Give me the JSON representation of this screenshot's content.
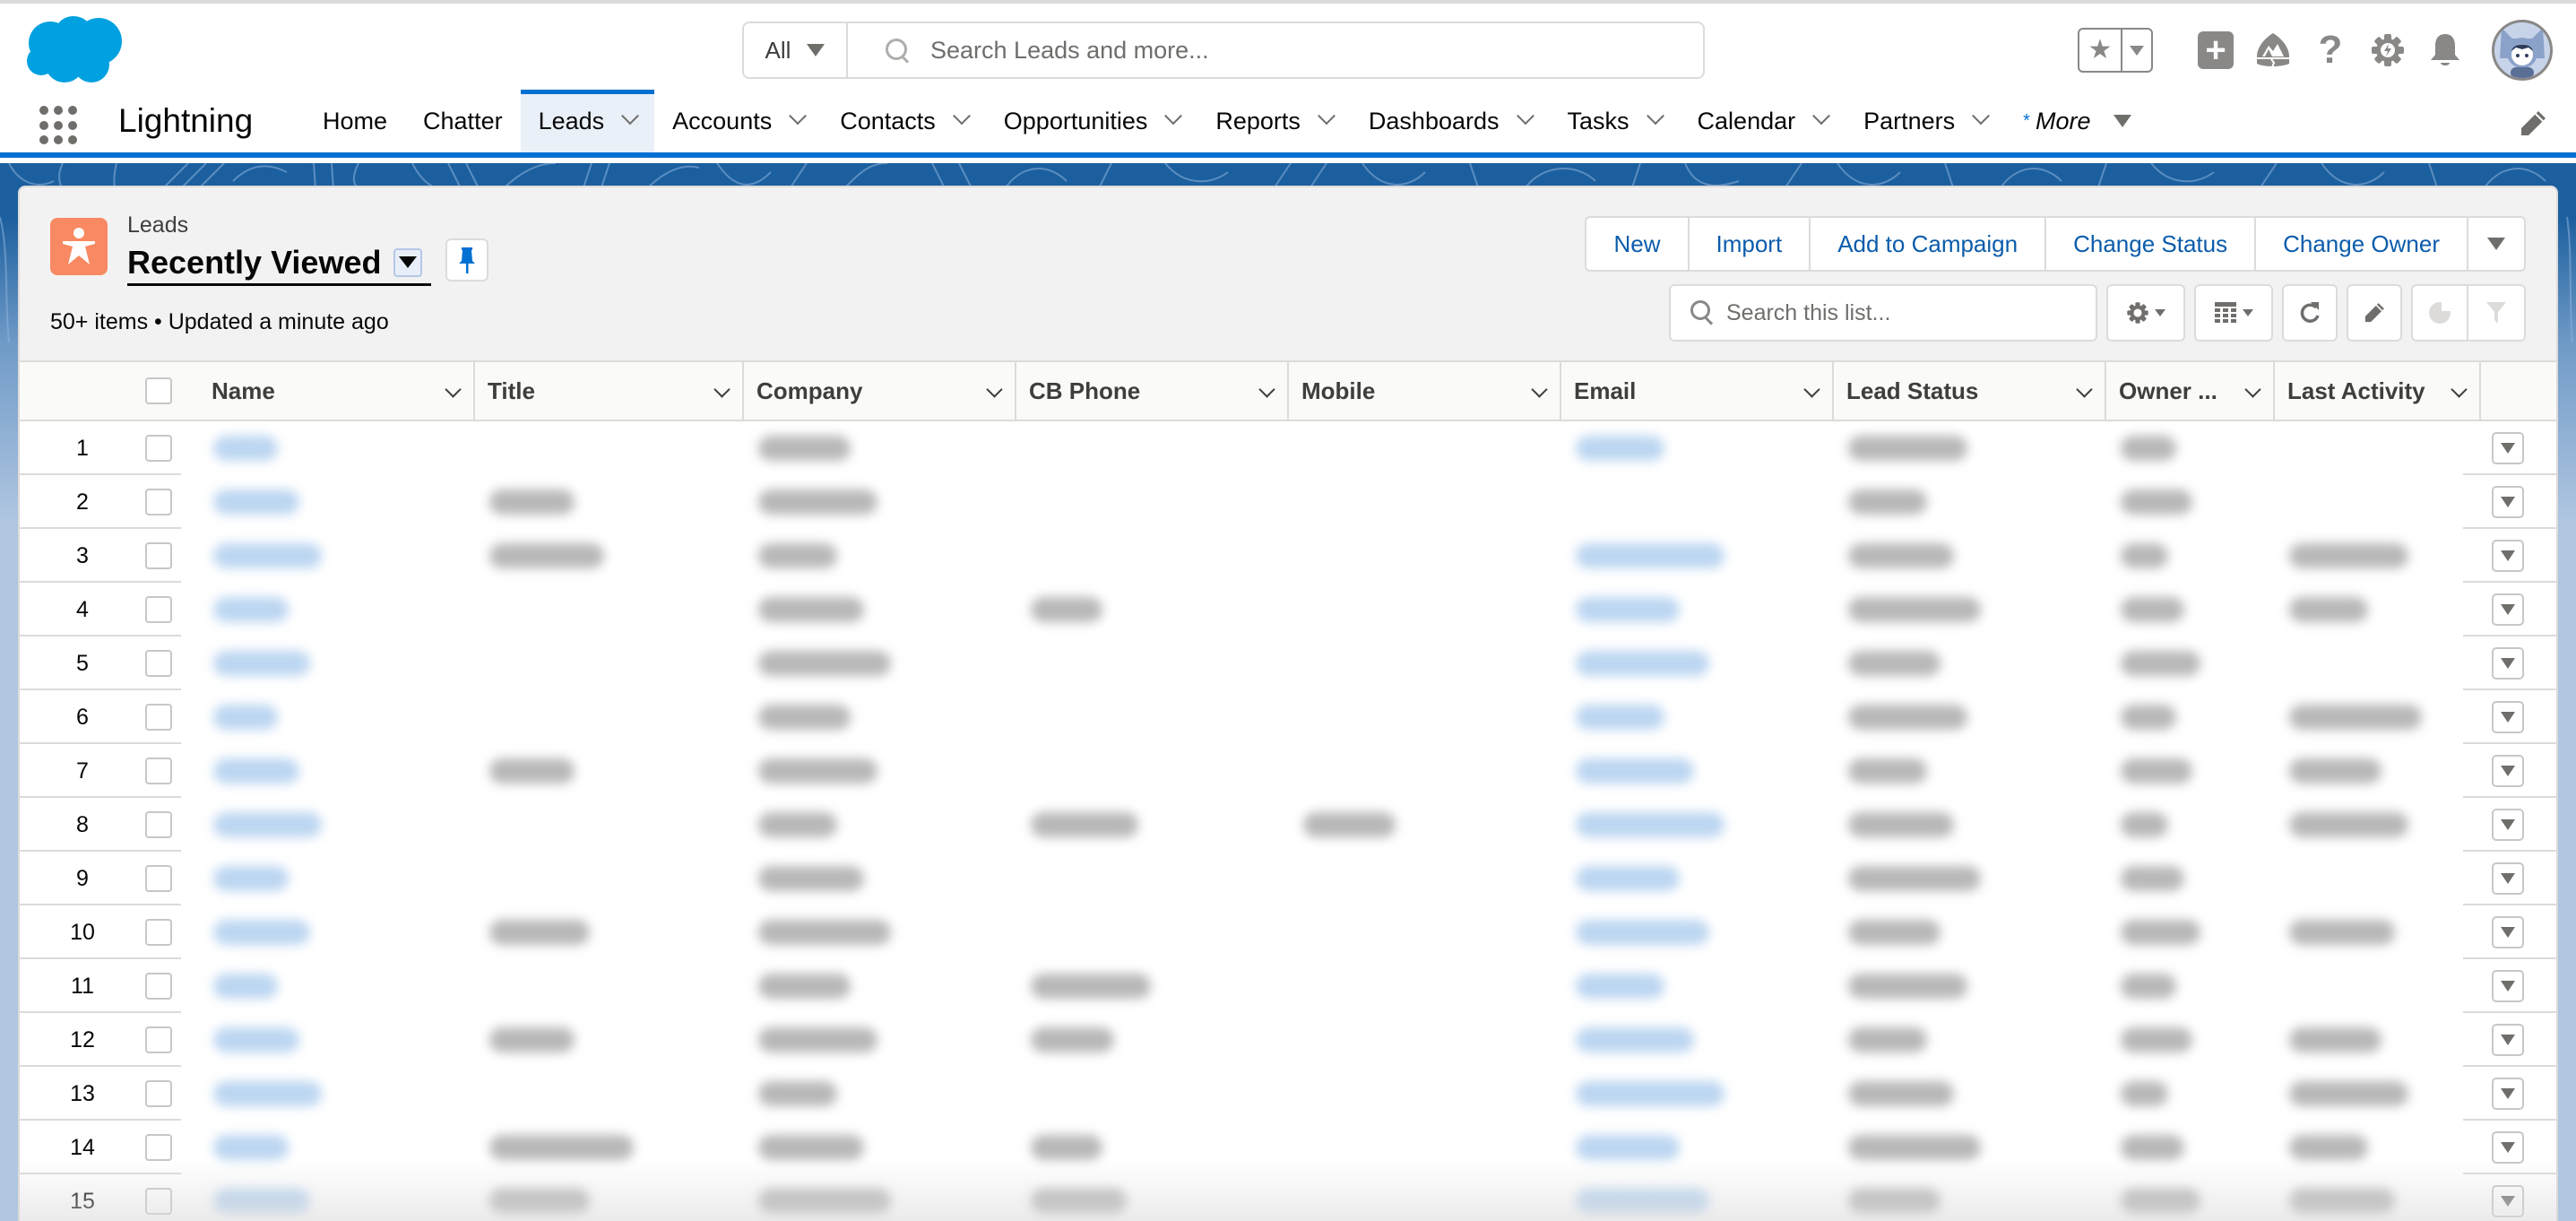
{
  "header": {
    "logo": "salesforce-cloud-logo",
    "search_scope": "All",
    "search_placeholder": "Search Leads and more...",
    "icons": [
      "favorites-star-icon",
      "favorites-dropdown-icon",
      "global-actions-plus-icon",
      "trailhead-icon",
      "help-icon",
      "setup-gear-icon",
      "notifications-bell-icon",
      "user-avatar"
    ]
  },
  "nav": {
    "app_name": "Lightning",
    "items": [
      {
        "label": "Home",
        "dropdown": false,
        "active": false
      },
      {
        "label": "Chatter",
        "dropdown": false,
        "active": false
      },
      {
        "label": "Leads",
        "dropdown": true,
        "active": true
      },
      {
        "label": "Accounts",
        "dropdown": true,
        "active": false
      },
      {
        "label": "Contacts",
        "dropdown": true,
        "active": false
      },
      {
        "label": "Opportunities",
        "dropdown": true,
        "active": false
      },
      {
        "label": "Reports",
        "dropdown": true,
        "active": false
      },
      {
        "label": "Dashboards",
        "dropdown": true,
        "active": false
      },
      {
        "label": "Tasks",
        "dropdown": true,
        "active": false
      },
      {
        "label": "Calendar",
        "dropdown": true,
        "active": false
      },
      {
        "label": "Partners",
        "dropdown": true,
        "active": false
      }
    ],
    "more_prefix": "*",
    "more_label": "More"
  },
  "list": {
    "object_label": "Leads",
    "view_name": "Recently Viewed",
    "meta": "50+ items • Updated a minute ago",
    "actions": [
      "New",
      "Import",
      "Add to Campaign",
      "Change Status",
      "Change Owner"
    ],
    "search_placeholder": "Search this list...",
    "colors": {
      "object_icon": "#f88962",
      "brand_blue": "#0070d2",
      "action_text": "#0b5cab"
    }
  },
  "table": {
    "columns": [
      "Name",
      "Title",
      "Company",
      "CB Phone",
      "Mobile",
      "Email",
      "Lead Status",
      "Owner ...",
      "Last Activity"
    ],
    "note": "cell values are blurred/redacted in the screenshot; true = cell contains a redacted value",
    "rows": [
      {
        "n": "1",
        "cells": [
          true,
          false,
          true,
          false,
          false,
          true,
          true,
          true,
          false
        ]
      },
      {
        "n": "2",
        "cells": [
          true,
          true,
          true,
          false,
          false,
          false,
          true,
          true,
          false
        ]
      },
      {
        "n": "3",
        "cells": [
          true,
          true,
          true,
          false,
          false,
          true,
          true,
          true,
          true
        ]
      },
      {
        "n": "4",
        "cells": [
          true,
          false,
          true,
          true,
          false,
          true,
          true,
          true,
          true
        ]
      },
      {
        "n": "5",
        "cells": [
          true,
          false,
          true,
          false,
          false,
          true,
          true,
          true,
          false
        ]
      },
      {
        "n": "6",
        "cells": [
          true,
          false,
          true,
          false,
          false,
          true,
          true,
          true,
          true
        ]
      },
      {
        "n": "7",
        "cells": [
          true,
          true,
          true,
          false,
          false,
          true,
          true,
          true,
          true
        ]
      },
      {
        "n": "8",
        "cells": [
          true,
          false,
          true,
          true,
          true,
          true,
          true,
          true,
          true
        ]
      },
      {
        "n": "9",
        "cells": [
          true,
          false,
          true,
          false,
          false,
          true,
          true,
          true,
          false
        ]
      },
      {
        "n": "10",
        "cells": [
          true,
          true,
          true,
          false,
          false,
          true,
          true,
          true,
          true
        ]
      },
      {
        "n": "11",
        "cells": [
          true,
          false,
          true,
          true,
          false,
          true,
          true,
          true,
          false
        ]
      },
      {
        "n": "12",
        "cells": [
          true,
          true,
          true,
          true,
          false,
          true,
          true,
          true,
          true
        ]
      },
      {
        "n": "13",
        "cells": [
          true,
          false,
          true,
          false,
          false,
          true,
          true,
          true,
          true
        ]
      },
      {
        "n": "14",
        "cells": [
          true,
          true,
          true,
          true,
          false,
          true,
          true,
          true,
          true
        ]
      },
      {
        "n": "15",
        "cells": [
          true,
          true,
          true,
          true,
          false,
          true,
          true,
          true,
          true
        ]
      }
    ]
  }
}
